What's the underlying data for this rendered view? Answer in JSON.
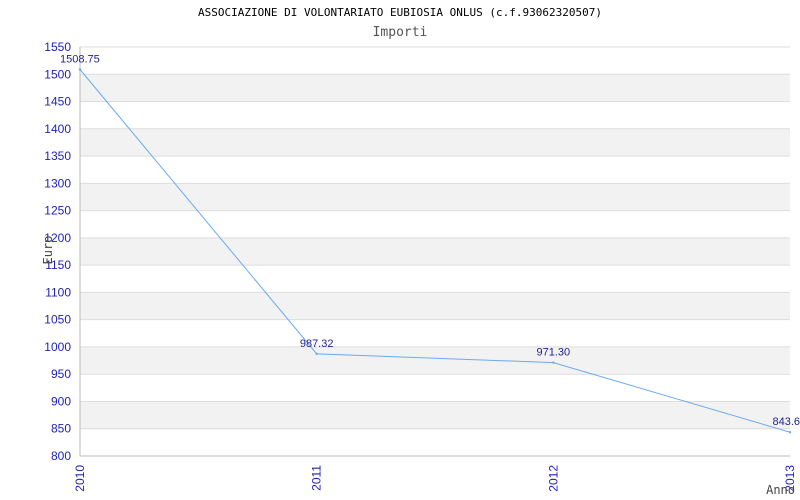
{
  "chart_data": {
    "type": "line",
    "title": "ASSOCIAZIONE DI VOLONTARIATO EUBIOSIA ONLUS (c.f.93062320507)",
    "subtitle": "Importi",
    "xlabel": "Anno",
    "ylabel": "Euro",
    "categories": [
      "2010",
      "2011",
      "2012",
      "2013"
    ],
    "values": [
      1508.75,
      987.32,
      971.3,
      843.6
    ],
    "data_labels": [
      "1508.75",
      "987.32",
      "971.30",
      "843.6"
    ],
    "ylim": [
      800,
      1550
    ],
    "yticks": [
      "800",
      "850",
      "900",
      "950",
      "1000",
      "1050",
      "1100",
      "1150",
      "1200",
      "1250",
      "1300",
      "1350",
      "1400",
      "1450",
      "1500",
      "1550"
    ],
    "grid": true,
    "colors": {
      "line": "#6aaaf0",
      "band": "#f2f2f2",
      "gridline": "#dddddd",
      "tick": "#1f1fb4",
      "label": "#1f1f8f"
    }
  }
}
